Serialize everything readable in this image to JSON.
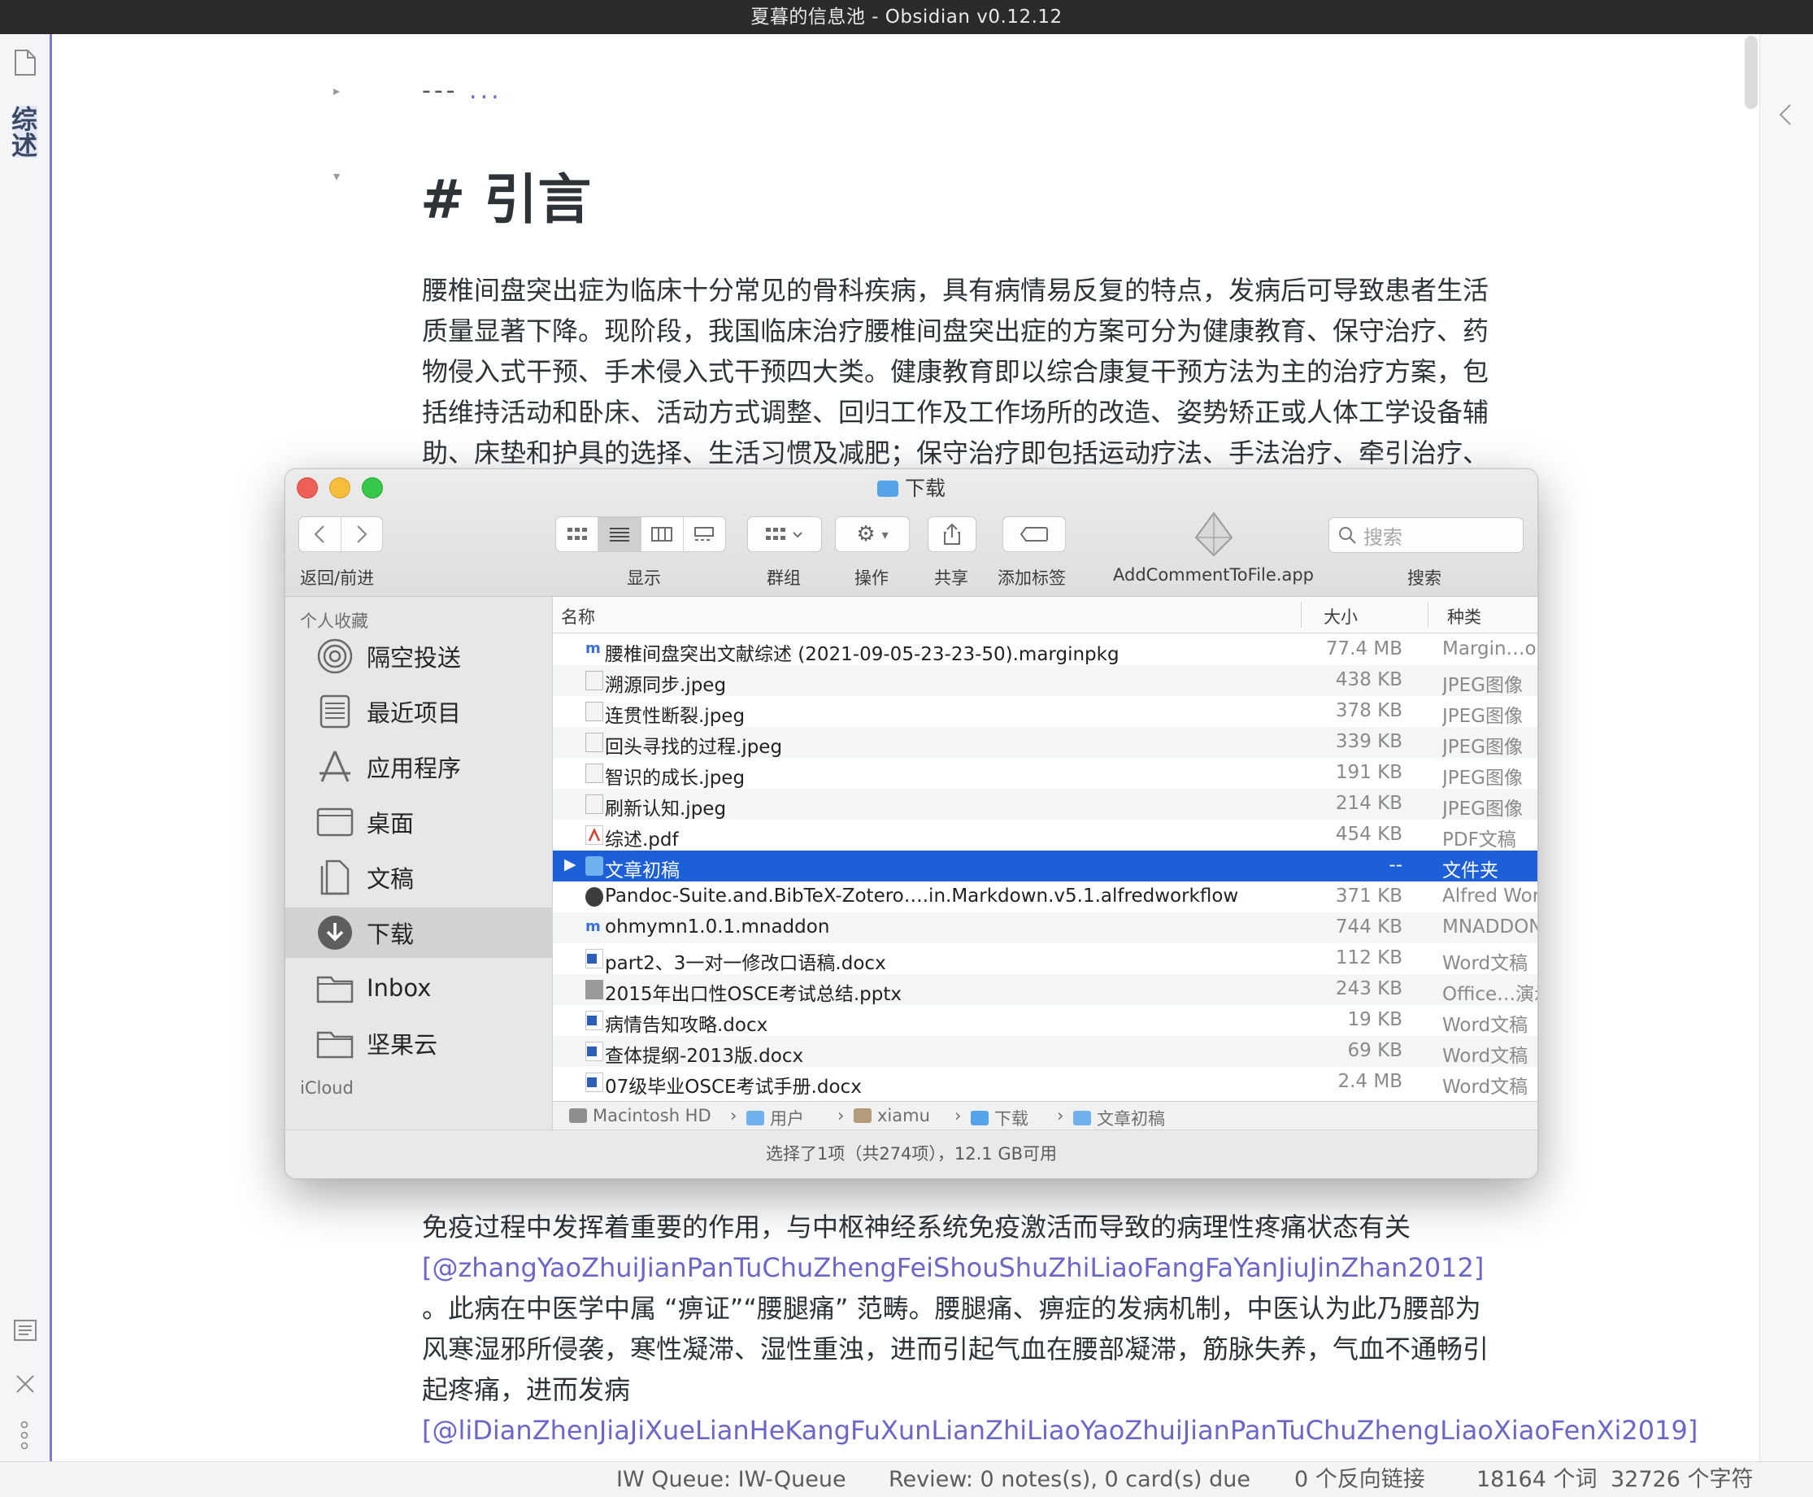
{
  "window": {
    "title": "夏暮的信息池 - Obsidian v0.12.12"
  },
  "ribbon": {
    "tab_label": "综述"
  },
  "editor": {
    "frontmatter": "---",
    "frontmatter_more": "...",
    "heading": "# 引言",
    "para1": "腰椎间盘突出症为临床十分常见的骨科疾病，具有病情易反复的特点，发病后可导致患者生活质量显著下降。现阶段，我国临床治疗腰椎间盘突出症的方案可分为健康教育、保守治疗、药物侵入式干预、手术侵入式干预四大类。健康教育即以综合康复干预方法为主的治疗方案，包括维持活动和卧床、活动方式调整、回归工作及工作场所的改造、姿势矫正或人体工学设备辅助、床垫和护具的选择、生活习惯及减肥；保守治疗即包括运动疗法、手法治疗、牵引治疗、物理因子治疗、针灸治疗、中医药治疗、心理治疗及",
    "para2_a": "免疫过程中发挥着重要的作用，与中枢神经系统免疫激活而导致的病理性疼痛状态有关",
    "cite1": "[@zhangYaoZhuiJianPanTuChuZhengFeiShouShuZhiLiaoFangFaYanJiuJinZhan2012]",
    "para2_b": " 。此病在中医学中属 “痹证”“腰腿痛” 范畴。腰腿痛、痹症的发病机制，中医认为此乃腰部为风寒湿邪所侵袭，寒性凝滞、湿性重浊，进而引起气血在腰部凝滞，筋脉失养，气血不通畅引起疼痛，进而发病",
    "cite2": "[@liDianZhenJiaJiXueLianHeKangFuXunLianZhiLiaoYaoZhuiJianPanTuChuZhengLiaoXiaoFenXi2019]"
  },
  "status": {
    "queue": "IW Queue: IW-Queue",
    "review": "Review: 0 notes(s), 0 card(s) due",
    "backlinks": "0 个反向链接",
    "words": "18164 个词",
    "chars": "32726 个字符"
  },
  "finder": {
    "title": "下载",
    "toolbar": {
      "back_forward": "返回/前进",
      "view": "显示",
      "group": "群组",
      "action": "操作",
      "share": "共享",
      "tags": "添加标签",
      "app": "AddCommentToFile.app",
      "search": "搜索",
      "search_placeholder": "搜索"
    },
    "sidebar": {
      "favorites_header": "个人收藏",
      "items": [
        {
          "label": "隔空投送",
          "icon": "airdrop-icon"
        },
        {
          "label": "最近项目",
          "icon": "recents-icon"
        },
        {
          "label": "应用程序",
          "icon": "applications-icon"
        },
        {
          "label": "桌面",
          "icon": "desktop-icon"
        },
        {
          "label": "文稿",
          "icon": "documents-icon"
        },
        {
          "label": "下载",
          "icon": "downloads-icon"
        },
        {
          "label": "Inbox",
          "icon": "folder-icon"
        },
        {
          "label": "坚果云",
          "icon": "folder-icon"
        }
      ],
      "icloud_header": "iCloud"
    },
    "columns": {
      "name": "名称",
      "size": "大小",
      "kind": "种类"
    },
    "files": [
      {
        "name": "腰椎间盘突出文献综述 (2021-09-05-23-23-50).marginpkg",
        "size": "77.4 MB",
        "kind": "Margin…oo",
        "icon": "marginnote-icon"
      },
      {
        "name": "溯源同步.jpeg",
        "size": "438 KB",
        "kind": "JPEG图像",
        "icon": "image-icon"
      },
      {
        "name": "连贯性断裂.jpeg",
        "size": "378 KB",
        "kind": "JPEG图像",
        "icon": "image-icon"
      },
      {
        "name": "回头寻找的过程.jpeg",
        "size": "339 KB",
        "kind": "JPEG图像",
        "icon": "image-icon"
      },
      {
        "name": "智识的成长.jpeg",
        "size": "191 KB",
        "kind": "JPEG图像",
        "icon": "image-icon"
      },
      {
        "name": "刷新认知.jpeg",
        "size": "214 KB",
        "kind": "JPEG图像",
        "icon": "image-icon"
      },
      {
        "name": "综述.pdf",
        "size": "454 KB",
        "kind": "PDF文稿",
        "icon": "pdf-icon"
      },
      {
        "name": "文章初稿",
        "size": "--",
        "kind": "文件夹",
        "icon": "folder-icon"
      },
      {
        "name": "Pandoc-Suite.and.BibTeX-Zotero….in.Markdown.v5.1.alfredworkflow",
        "size": "371 KB",
        "kind": "Alfred Work",
        "icon": "alfred-icon"
      },
      {
        "name": "ohmymn1.0.1.mnaddon",
        "size": "744 KB",
        "kind": "MNADDON",
        "icon": "marginnote-icon"
      },
      {
        "name": "part2、3一对一修改口语稿.docx",
        "size": "112 KB",
        "kind": "Word文稿",
        "icon": "word-icon"
      },
      {
        "name": "2015年出口性OSCE考试总结.pptx",
        "size": "243 KB",
        "kind": "Office…演示",
        "icon": "pptx-icon"
      },
      {
        "name": "病情告知攻略.docx",
        "size": "19 KB",
        "kind": "Word文稿",
        "icon": "word-icon"
      },
      {
        "name": "查体提纲-2013版.docx",
        "size": "69 KB",
        "kind": "Word文稿",
        "icon": "word-icon"
      },
      {
        "name": "07级毕业OSCE考试手册.docx",
        "size": "2.4 MB",
        "kind": "Word文稿",
        "icon": "word-icon"
      }
    ],
    "path": [
      "Macintosh HD",
      "用户",
      "xiamu",
      "下载",
      "文章初稿"
    ],
    "status": "选择了1项（共274项），12.1 GB可用",
    "colors": {
      "selection": "#1c5fd9",
      "close": "#ee5f57",
      "minimize": "#f5bd3a",
      "zoom": "#37c749",
      "accent": "#7d7ad4",
      "link": "#6c66c9"
    }
  }
}
